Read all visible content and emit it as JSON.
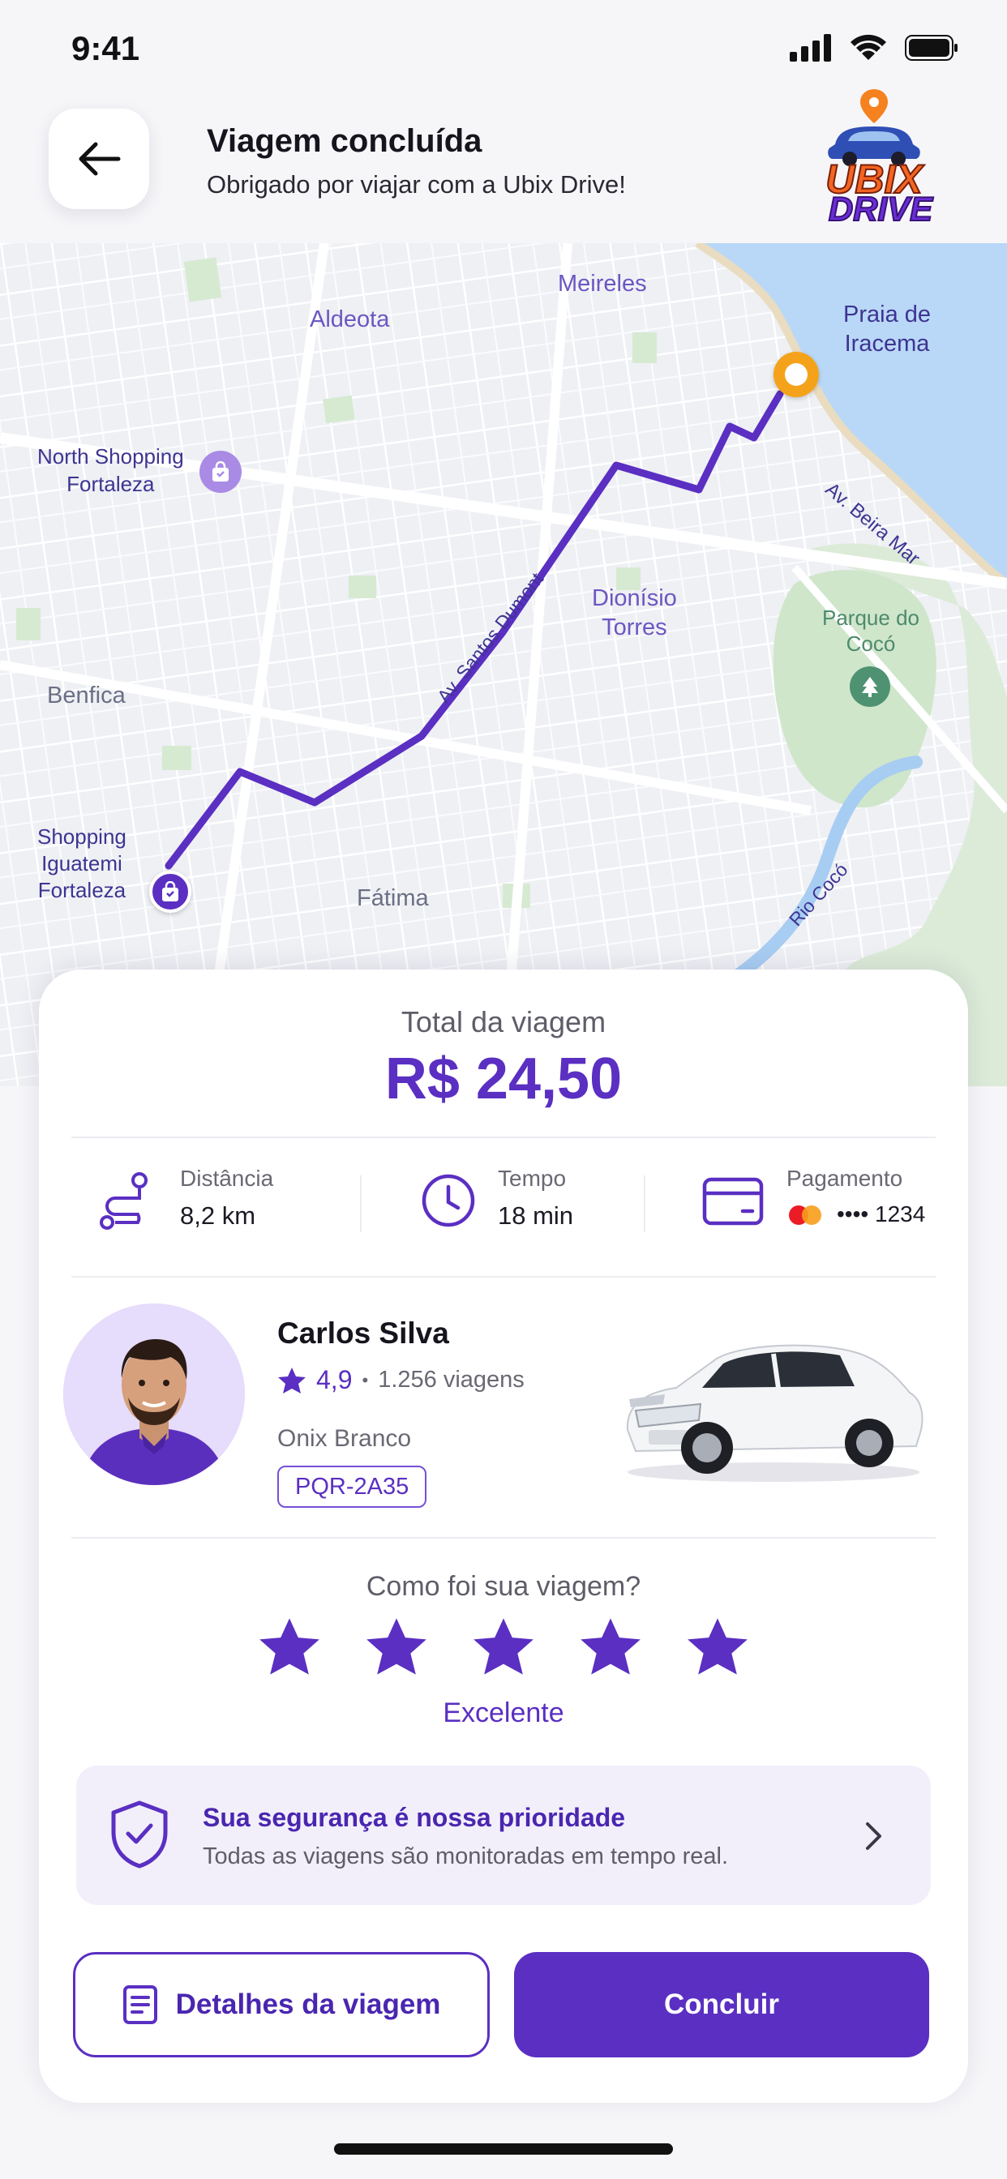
{
  "status_bar": {
    "time": "9:41"
  },
  "header": {
    "title": "Viagem concluída",
    "subtitle": "Obrigado por viajar com a Ubix Drive!",
    "logo_line1": "UBIX",
    "logo_line2": "DRIVE"
  },
  "map": {
    "labels": {
      "meireles": "Meireles",
      "aldeota": "Aldeota",
      "praia": "Praia de\nIracema",
      "north_shopping": "North Shopping\nFortaleza",
      "beira_mar": "Av. Beira Mar",
      "santos_dumont": "Av. Santos Dumont",
      "dionisio": "Dionísio\nTorres",
      "parque": "Parque do\nCocó",
      "benfica": "Benfica",
      "iguatemi": "Shopping\nIguatemi\nFortaleza",
      "fatima": "Fátima",
      "rio_coco": "Rio Cocó"
    },
    "route_color": "#5a2fc2",
    "destination_color": "#f5a21b"
  },
  "trip": {
    "total_label": "Total da viagem",
    "total_value": "R$ 24,50",
    "distance_label": "Distância",
    "distance_value": "8,2 km",
    "time_label": "Tempo",
    "time_value": "18 min",
    "payment_label": "Pagamento",
    "payment_value": "•••• 1234"
  },
  "driver": {
    "name": "Carlos Silva",
    "rating": "4,9",
    "separator": "•",
    "trips": "1.256 viagens",
    "car_model": "Onix Branco",
    "plate": "PQR-2A35"
  },
  "feedback": {
    "question": "Como foi sua viagem?",
    "stars": 5,
    "rating_word": "Excelente"
  },
  "safety": {
    "title": "Sua segurança é nossa prioridade",
    "subtitle": "Todas as viagens são monitoradas em tempo real."
  },
  "actions": {
    "details": "Detalhes da viagem",
    "done": "Concluir"
  },
  "colors": {
    "accent": "#5a2fc2",
    "background": "#f6f6f9"
  }
}
